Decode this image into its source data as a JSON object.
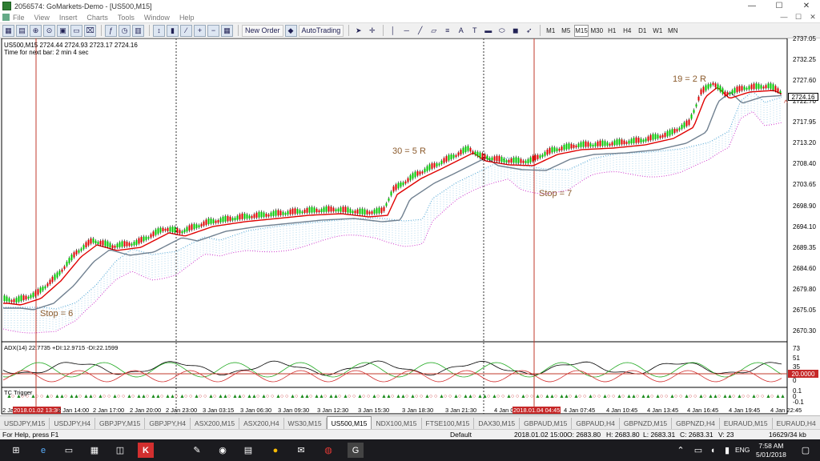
{
  "window": {
    "title": "2056574: GoMarkets-Demo - [US500,M15]",
    "buttons": [
      "—",
      "☐",
      "✕"
    ]
  },
  "menu": [
    "File",
    "View",
    "Insert",
    "Charts",
    "Tools",
    "Window",
    "Help"
  ],
  "toolbar": {
    "new_order_label": "New Order",
    "autotrading_label": "AutoTrading",
    "timeframes": [
      "M1",
      "M5",
      "M15",
      "M30",
      "H1",
      "H4",
      "D1",
      "W1",
      "MN"
    ],
    "active_timeframe": "M15"
  },
  "chart": {
    "symbol_line": "US500,M15  2724.44 2724.93 2723.17 2724.16",
    "timer_line": "Time for next bar: 2 min 4 sec",
    "current_price": "2724.16",
    "price_labels": [
      "2737.05",
      "2732.25",
      "2727.60",
      "2722.70",
      "2717.95",
      "2713.20",
      "2708.40",
      "2703.65",
      "2698.90",
      "2694.10",
      "2689.35",
      "2684.60",
      "2679.80",
      "2675.05",
      "2670.30"
    ],
    "indicator_label": "ADX(14) 22.7735 +DI:12.9715 -DI:22.1599",
    "indicator_levels": [
      "73",
      "51",
      "35",
      "20",
      "0"
    ],
    "indicator_level_highlight": "20.0000",
    "tc_label": "TC Trigger",
    "tc_levels": [
      "0.1",
      "0",
      "-0.1"
    ],
    "date_labels": [
      "2 Jan 2018",
      "2 Jan 14:00",
      "2 Jan 17:00",
      "2 Jan 20:00",
      "2 Jan 23:00",
      "3 Jan 03:15",
      "3 Jan 06:30",
      "3 Jan 09:30",
      "3 Jan 12:30",
      "3 Jan 15:30",
      "3 Jan 18:30",
      "3 Jan 21:30",
      "4 Jan 0",
      "4 Jan 07:45",
      "4 Jan 10:45",
      "4 Jan 13:45",
      "4 Jan 16:45",
      "4 Jan 19:45",
      "4 Jan 22:45"
    ],
    "highlight_dates": [
      "2018.01.02 13:30",
      "2018.01.04 04:45"
    ],
    "annotations": {
      "stop6": "Stop = 6",
      "r5": "30 = 5 R",
      "stop7": "Stop = 7",
      "r2": "19 = 2 R"
    },
    "colors": {
      "candle_up": "#00c800",
      "candle_down": "#e00000",
      "ema_fast": "#e00000",
      "ema_slow": "#708090",
      "cloud": "#4aa3d4",
      "cloud_lower": "#cc33cc",
      "vline_red": "#c0392b"
    }
  },
  "tabs": [
    "USDJPY,M15",
    "USDJPY,H4",
    "GBPJPY,M15",
    "GBPJPY,H4",
    "ASX200,M15",
    "ASX200,H4",
    "WS30,M15",
    "US500,M15",
    "NDX100,M15",
    "FTSE100,M15",
    "DAX30,M15",
    "GBPAUD,M15",
    "GBPAUD,H4",
    "GBPNZD,M15",
    "GBPNZD,H4",
    "EURAUD,M15",
    "EURAUD,H4",
    "EUR"
  ],
  "active_tab": "US500,M15",
  "status": {
    "help": "For Help, press F1",
    "profile": "Default",
    "datetime": "2018.01.02 15:00",
    "open": "O: 2683.80",
    "high": "H: 2683.80",
    "low": "L: 2683.31",
    "close": "C: 2683.31",
    "volume": "V: 23",
    "traffic": "16629/34 kb"
  },
  "taskbar": {
    "lang": "ENG",
    "time": "7:58 AM",
    "date": "5/01/2018"
  }
}
